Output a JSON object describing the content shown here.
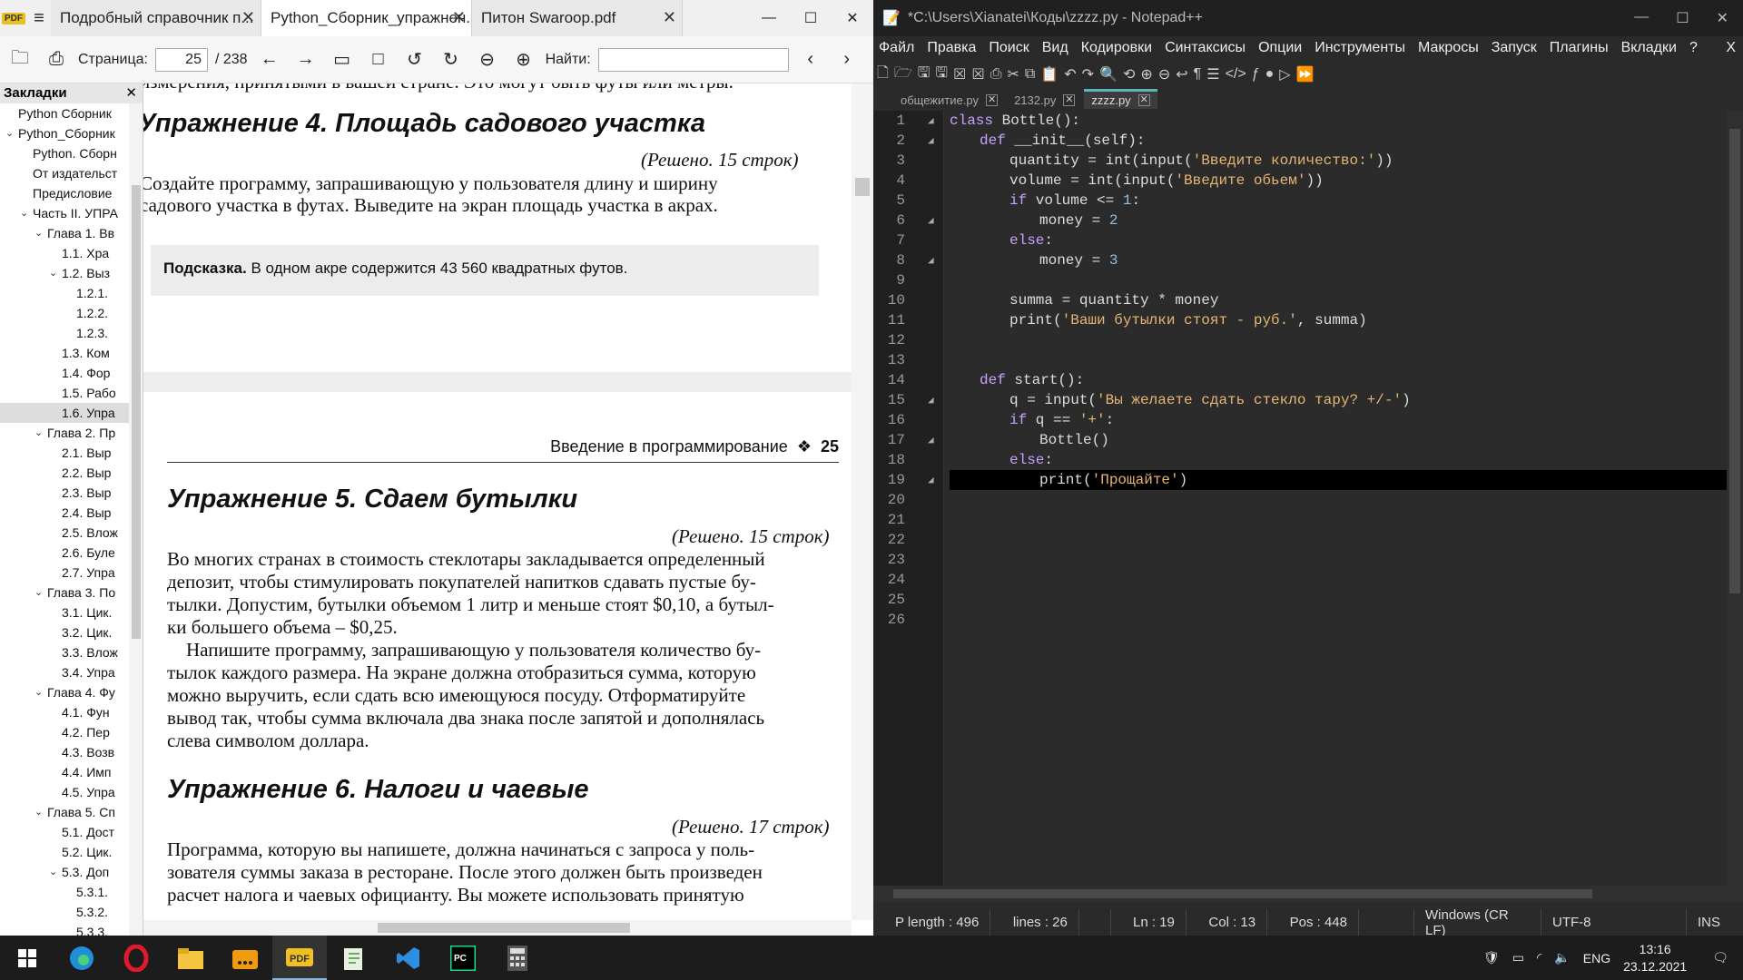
{
  "pdf_viewer": {
    "tabs": [
      "Подробный справочник п...",
      "Python_Сборник_упражнен...",
      "Питон Swaroop.pdf"
    ],
    "toolbar": {
      "page_label": "Страница:",
      "page_current": "25",
      "page_total": "/ 238",
      "find_label": "Найти:"
    },
    "bookmarks_title": "Закладки",
    "bookmarks": [
      {
        "label": "Python Сборник",
        "indent": 1,
        "caret": ""
      },
      {
        "label": "Python_Сборник",
        "indent": 1,
        "caret": "v"
      },
      {
        "label": "Python. Сборн",
        "indent": 2,
        "caret": ""
      },
      {
        "label": "От издательст",
        "indent": 2,
        "caret": ""
      },
      {
        "label": "Предисловие",
        "indent": 2,
        "caret": ""
      },
      {
        "label": "Часть II. УПРА",
        "indent": 2,
        "caret": "v"
      },
      {
        "label": "Глава 1. Вв",
        "indent": 3,
        "caret": "v"
      },
      {
        "label": "1.1. Хра",
        "indent": 4,
        "caret": ""
      },
      {
        "label": "1.2. Выз",
        "indent": 4,
        "caret": "v"
      },
      {
        "label": "1.2.1.",
        "indent": 5,
        "caret": ""
      },
      {
        "label": "1.2.2.",
        "indent": 5,
        "caret": ""
      },
      {
        "label": "1.2.3.",
        "indent": 5,
        "caret": ""
      },
      {
        "label": "1.3. Ком",
        "indent": 4,
        "caret": ""
      },
      {
        "label": "1.4. Фор",
        "indent": 4,
        "caret": ""
      },
      {
        "label": "1.5. Рабо",
        "indent": 4,
        "caret": ""
      },
      {
        "label": "1.6. Упра",
        "indent": 4,
        "caret": "",
        "selected": true
      },
      {
        "label": "Глава 2. Пр",
        "indent": 3,
        "caret": "v"
      },
      {
        "label": "2.1. Выр",
        "indent": 4,
        "caret": ""
      },
      {
        "label": "2.2. Выр",
        "indent": 4,
        "caret": ""
      },
      {
        "label": "2.3. Выр",
        "indent": 4,
        "caret": ""
      },
      {
        "label": "2.4. Выр",
        "indent": 4,
        "caret": ""
      },
      {
        "label": "2.5. Влож",
        "indent": 4,
        "caret": ""
      },
      {
        "label": "2.6. Буле",
        "indent": 4,
        "caret": ""
      },
      {
        "label": "2.7. Упра",
        "indent": 4,
        "caret": ""
      },
      {
        "label": "Глава 3. По",
        "indent": 3,
        "caret": "v"
      },
      {
        "label": "3.1. Цик.",
        "indent": 4,
        "caret": ""
      },
      {
        "label": "3.2. Цик.",
        "indent": 4,
        "caret": ""
      },
      {
        "label": "3.3. Влож",
        "indent": 4,
        "caret": ""
      },
      {
        "label": "3.4. Упра",
        "indent": 4,
        "caret": ""
      },
      {
        "label": "Глава 4. Фу",
        "indent": 3,
        "caret": "v"
      },
      {
        "label": "4.1. Фун",
        "indent": 4,
        "caret": ""
      },
      {
        "label": "4.2. Пер",
        "indent": 4,
        "caret": ""
      },
      {
        "label": "4.3. Возв",
        "indent": 4,
        "caret": ""
      },
      {
        "label": "4.4. Имп",
        "indent": 4,
        "caret": ""
      },
      {
        "label": "4.5. Упра",
        "indent": 4,
        "caret": ""
      },
      {
        "label": "Глава 5. Сп",
        "indent": 3,
        "caret": "v"
      },
      {
        "label": "5.1. Дост",
        "indent": 4,
        "caret": ""
      },
      {
        "label": "5.2. Цик.",
        "indent": 4,
        "caret": ""
      },
      {
        "label": "5.3. Доп",
        "indent": 4,
        "caret": "v"
      },
      {
        "label": "5.3.1.",
        "indent": 5,
        "caret": ""
      },
      {
        "label": "5.3.2.",
        "indent": 5,
        "caret": ""
      },
      {
        "label": "5.3.3.",
        "indent": 5,
        "caret": ""
      }
    ],
    "doc": {
      "top_cut": "измерения, принятыми в вашей стране. Это могут быть футы или метры.",
      "ex4_title": "Упражнение 4. Площадь садового участка",
      "ex4_solved": "(Решено. 15 строк)",
      "ex4_text_1": "Создайте программу, запрашивающую у пользователя длину и ширину",
      "ex4_text_2": "садового участка в футах. Выведите на экран площадь участка в акрах.",
      "hint_label": "Подсказка.",
      "hint_text": " В одном акре содержится 43 560 квадратных футов.",
      "running_head": "Введение в программирование",
      "running_sym": "❖",
      "page_no": "25",
      "ex5_title": "Упражнение 5. Сдаем бутылки",
      "ex5_solved": "(Решено. 15 строк)",
      "ex5_p1_1": "Во многих странах в стоимость стеклотары закладывается определенный",
      "ex5_p1_2": "депозит, чтобы стимулировать покупателей напитков сдавать пустые бу-",
      "ex5_p1_3": "тылки. Допустим, бутылки объемом 1 литр и меньше стоят $0,10, а бутыл-",
      "ex5_p1_4": "ки большего объема – $0,25.",
      "ex5_p2_1": "    Напишите программу, запрашивающую у пользователя количество бу-",
      "ex5_p2_2": "тылок каждого размера. На экране должна отобразиться сумма, которую",
      "ex5_p2_3": "можно выручить, если сдать всю имеющуюся посуду. Отформатируйте",
      "ex5_p2_4": "вывод так, чтобы сумма включала два знака после запятой и дополнялась",
      "ex5_p2_5": "слева символом доллара.",
      "ex6_title": "Упражнение 6. Налоги и чаевые",
      "ex6_solved": "(Решено. 17 строк)",
      "ex6_1": "Программа, которую вы напишете, должна начинаться с запроса у поль-",
      "ex6_2": "зователя суммы заказа в ресторане. После этого должен быть произведен",
      "ex6_3": "расчет налога и чаевых официанту. Вы можете использовать принятую"
    }
  },
  "notepad": {
    "title": "*C:\\Users\\Xianatei\\Коды\\zzzz.py - Notepad++",
    "menu": [
      "Файл",
      "Правка",
      "Поиск",
      "Вид",
      "Кодировки",
      "Синтаксисы",
      "Опции",
      "Инструменты",
      "Макросы",
      "Запуск",
      "Плагины",
      "Вкладки",
      "?"
    ],
    "menu_close": "X",
    "tabs": [
      "общежитие.py",
      "2132.py",
      "zzzz.py"
    ],
    "line_numbers": [
      "1",
      "2",
      "3",
      "4",
      "5",
      "6",
      "7",
      "8",
      "9",
      "10",
      "11",
      "12",
      "13",
      "14",
      "15",
      "16",
      "17",
      "18",
      "19",
      "20",
      "21",
      "22",
      "23",
      "24",
      "25",
      "26"
    ],
    "code": {
      "l1_kw": "class",
      "l1_rest": " Bottle():",
      "l2_kw": "def",
      "l2_rest": " __init__(self):",
      "l3_a": "quantity = int(input(",
      "l3_s": "'Введите количество:'",
      "l3_b": "))",
      "l4_a": "volume = int(input(",
      "l4_s": "'Введите обьем'",
      "l4_b": "))",
      "l5_kw": "if",
      "l5_a": " volume <= ",
      "l5_n": "1",
      "l5_b": ":",
      "l6_a": "money = ",
      "l6_n": "2",
      "l7_kw": "else",
      "l7_b": ":",
      "l8_a": "money = ",
      "l8_n": "3",
      "l10": "summa = quantity * money",
      "l11_a": "print(",
      "l11_s": "'Ваши бутылки стоят - руб.'",
      "l11_b": ", summa)",
      "l14_kw": "def",
      "l14_rest": " start():",
      "l15_a": "q = input(",
      "l15_s": "'Вы желаете сдать стекло тару? +/-'",
      "l15_b": ")",
      "l16_kw": "if",
      "l16_a": " q == ",
      "l16_s": "'+'",
      "l16_b": ":",
      "l17": "Bottle()",
      "l18_kw": "else",
      "l18_b": ":",
      "l19_a": "print(",
      "l19_s": "'Прощайте'",
      "l19_b": ")"
    },
    "status": {
      "length": "P length : 496",
      "lines": "lines : 26",
      "ln": "Ln : 19",
      "col": "Col : 13",
      "pos": "Pos : 448",
      "eol": "Windows (CR LF)",
      "enc": "UTF-8",
      "mode": "INS"
    }
  },
  "taskbar": {
    "lang": "ENG",
    "time": "13:16",
    "date": "23.12.2021"
  },
  "colors": {
    "keyword": "#c6a0ff",
    "string": "#e6b673",
    "number": "#8fbfdf",
    "tab_accent": "#5fb5b5"
  }
}
